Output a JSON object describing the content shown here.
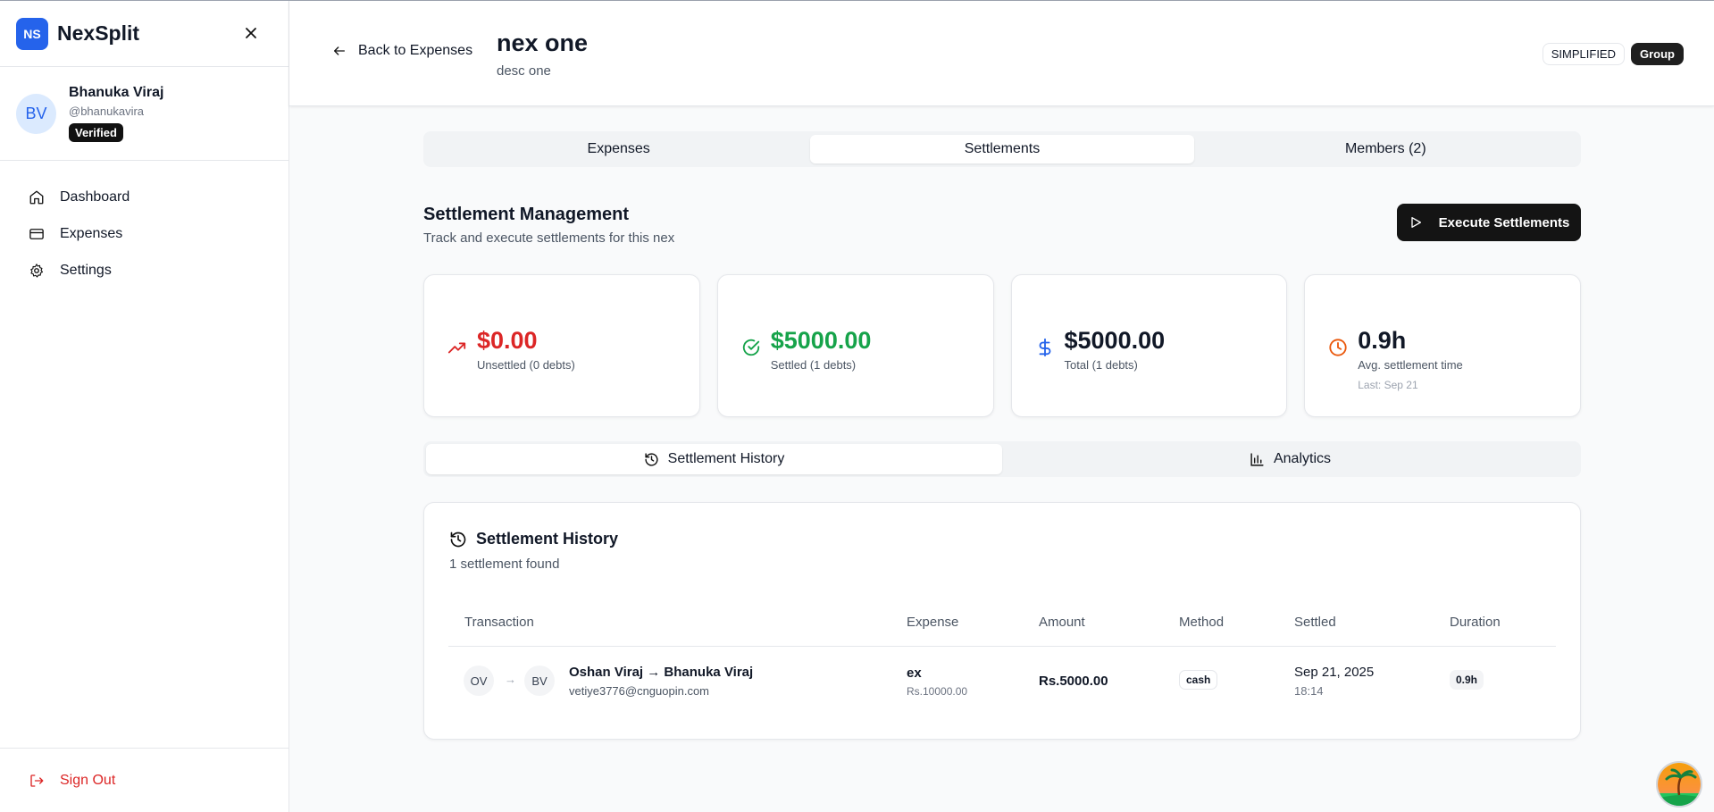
{
  "brand": {
    "logo": "NS",
    "name": "NexSplit"
  },
  "profile": {
    "initials": "BV",
    "name": "Bhanuka Viraj",
    "handle": "@bhanukavira",
    "badge": "Verified"
  },
  "nav": [
    {
      "label": "Dashboard",
      "icon": "home-icon"
    },
    {
      "label": "Expenses",
      "icon": "card-icon"
    },
    {
      "label": "Settings",
      "icon": "gear-icon"
    }
  ],
  "signout": "Sign Out",
  "header": {
    "back": "Back to Expenses",
    "title": "nex one",
    "subtitle": "desc one",
    "badge_mode": "SIMPLIFIED",
    "badge_type": "Group"
  },
  "tabs": [
    "Expenses",
    "Settlements",
    "Members (2)"
  ],
  "active_tab": "Settlements",
  "section": {
    "title": "Settlement Management",
    "desc": "Track and execute settlements for this nex",
    "execute_button": "Execute Settlements"
  },
  "cards": [
    {
      "value": "$0.00",
      "label": "Unsettled (0 debts)",
      "color": "#dc2626",
      "icon": "trending-up-icon"
    },
    {
      "value": "$5000.00",
      "label": "Settled (1 debts)",
      "color": "#16a34a",
      "icon": "check-circle-icon"
    },
    {
      "value": "$5000.00",
      "label": "Total (1 debts)",
      "color": "#111827",
      "icon": "dollar-icon"
    },
    {
      "value": "0.9h",
      "label": "Avg. settlement time",
      "sub": "Last: Sep 21",
      "color": "#111827",
      "icon": "clock-icon"
    }
  ],
  "subtabs": [
    "Settlement History",
    "Analytics"
  ],
  "history": {
    "title": "Settlement History",
    "count": "1 settlement found",
    "columns": [
      "Transaction",
      "Expense",
      "Amount",
      "Method",
      "Settled",
      "Duration"
    ],
    "rows": [
      {
        "from_initials": "OV",
        "to_initials": "BV",
        "arrow": "→",
        "names": "Oshan Viraj → Bhanuka Viraj",
        "email": "vetiye3776@cnguopin.com",
        "expense": "ex",
        "expense_amount": "Rs.10000.00",
        "amount": "Rs.5000.00",
        "method": "cash",
        "settled_date": "Sep 21, 2025",
        "settled_time": "18:14",
        "duration": "0.9h"
      }
    ]
  },
  "colors": {
    "accent": "#2563eb",
    "danger": "#dc2626",
    "success": "#16a34a",
    "warning": "#ea580c"
  }
}
